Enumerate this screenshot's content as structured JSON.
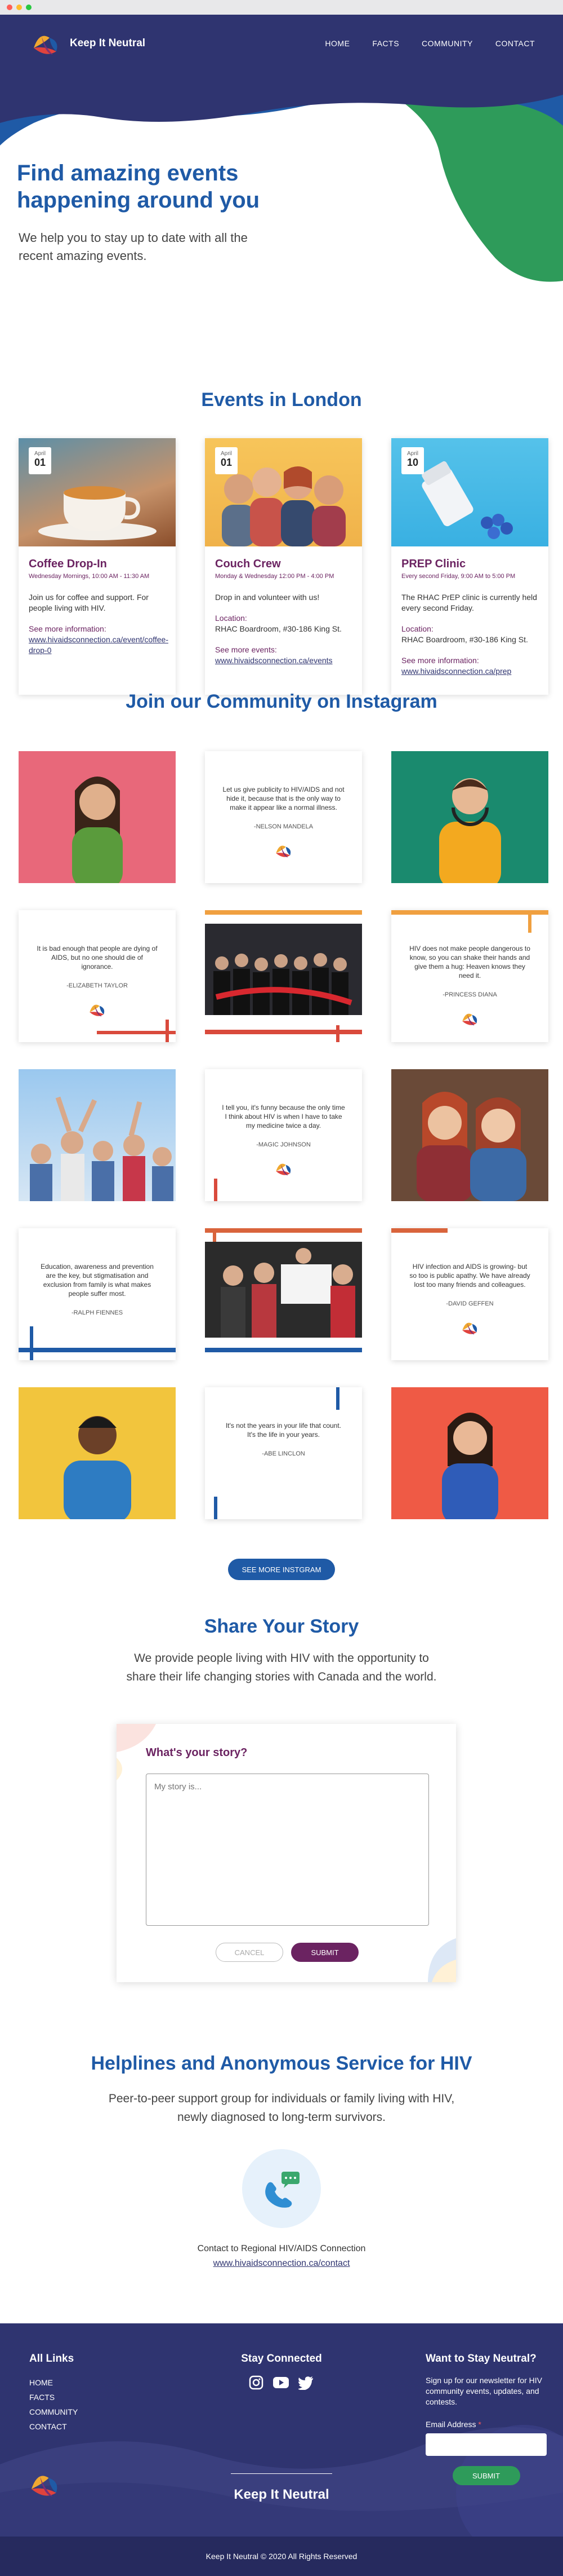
{
  "brand": {
    "name": "Keep It Neutral"
  },
  "nav": [
    "HOME",
    "FACTS",
    "COMMUNITY",
    "CONTACT"
  ],
  "hero": {
    "title": "Find amazing events happening around you",
    "subtitle": "We help you to stay up to date with all the recent amazing events."
  },
  "events": {
    "title": "Events in London",
    "cards": [
      {
        "month": "April",
        "day": "01",
        "title": "Coffee Drop-In",
        "time": "Wednesday Mornings, 10:00 AM - 11:30 AM",
        "desc": "Join us for coffee and support. For people living with HIV.",
        "label": "See more information:",
        "link": "www.hivaidsconnection.ca/event/coffee-drop-0"
      },
      {
        "month": "April",
        "day": "01",
        "title": "Couch Crew",
        "time": "Monday & Wednesday 12:00 PM - 4:00 PM",
        "desc": "Drop in and volunteer with us!",
        "label": "Location:",
        "location": "RHAC Boardroom, #30-186 King St.",
        "label2": "See more events:",
        "link": "www.hivaidsconnection.ca/events"
      },
      {
        "month": "April",
        "day": "10",
        "title": "PREP Clinic",
        "time": "Every second Friday, 9:00 AM to 5:00 PM",
        "desc": "The RHAC PrEP clinic is currently held every second Friday.",
        "label": "Location:",
        "location": "RHAC Boardroom, #30-186 King St.",
        "label2": "See more information:",
        "link": "www.hivaidsconnection.ca/prep"
      }
    ]
  },
  "instagram": {
    "title": "Join our Community on Instagram",
    "quotes": [
      {
        "text": "Let us give publicity to HIV/AIDS and not hide it, because that is the only way to make it appear like a normal illness.",
        "author": "-NELSON MANDELA"
      },
      {
        "text": "It is bad enough that people are dying of AIDS, but no one should die of ignorance.",
        "author": "-ELIZABETH TAYLOR"
      },
      {
        "text": "HIV does not make people dangerous to know, so you can shake their hands and give them a hug: Heaven knows they need it.",
        "author": "-PRINCESS DIANA"
      },
      {
        "text": "I tell you, it's funny because the only time I think about HIV is when I have to take my medicine twice a day.",
        "author": "-MAGIC JOHNSON"
      },
      {
        "text": "Education, awareness and prevention are the key, but stigmatisation and exclusion from family is what makes people suffer most.",
        "author": "-RALPH FIENNES"
      },
      {
        "text": "HIV infection and AIDS is growing- but so too is public apathy. We have already lost too many friends and colleagues.",
        "author": "-DAVID GEFFEN"
      },
      {
        "text": "It's not the years in your life that count. It's the life in your years.",
        "author": "-ABE LINCLON"
      }
    ],
    "button": "SEE MORE INSTGRAM"
  },
  "story": {
    "title": "Share Your Story",
    "subtitle": "We provide people living with HIV with the opportunity to share their life changing stories with Canada and the world.",
    "card_title": "What's your story?",
    "placeholder": "My story is...",
    "cancel": "CANCEL",
    "submit": "SUBMIT"
  },
  "help": {
    "title": "Helplines and Anonymous Service for HIV",
    "subtitle": "Peer-to-peer support group for individuals or family living with HIV, newly diagnosed to long-term survivors.",
    "contact": "Contact to Regional HIV/AIDS Connection",
    "link": "www.hivaidsconnection.ca/contact"
  },
  "footer": {
    "links_title": "All Links",
    "links": [
      "HOME",
      "FACTS",
      "COMMUNITY",
      "CONTACT"
    ],
    "social_title": "Stay Connected",
    "newsletter_title": "Want to Stay Neutral?",
    "newsletter_text": "Sign up for our newsletter for HIV community events, updates, and contests.",
    "email_label": "Email Address",
    "required": "*",
    "submit": "SUBMIT",
    "brand": "Keep It Neutral",
    "copyright": "Keep It Neutral © 2020 All Rights Reserved"
  },
  "colors": {
    "navy": "#2f3470",
    "blue": "#1f5aa6",
    "purple": "#6b2361",
    "green": "#2e9b5a"
  },
  "icons": [
    "brand-logo-icon",
    "instagram-icon",
    "youtube-icon",
    "twitter-icon",
    "phone-chat-icon"
  ]
}
